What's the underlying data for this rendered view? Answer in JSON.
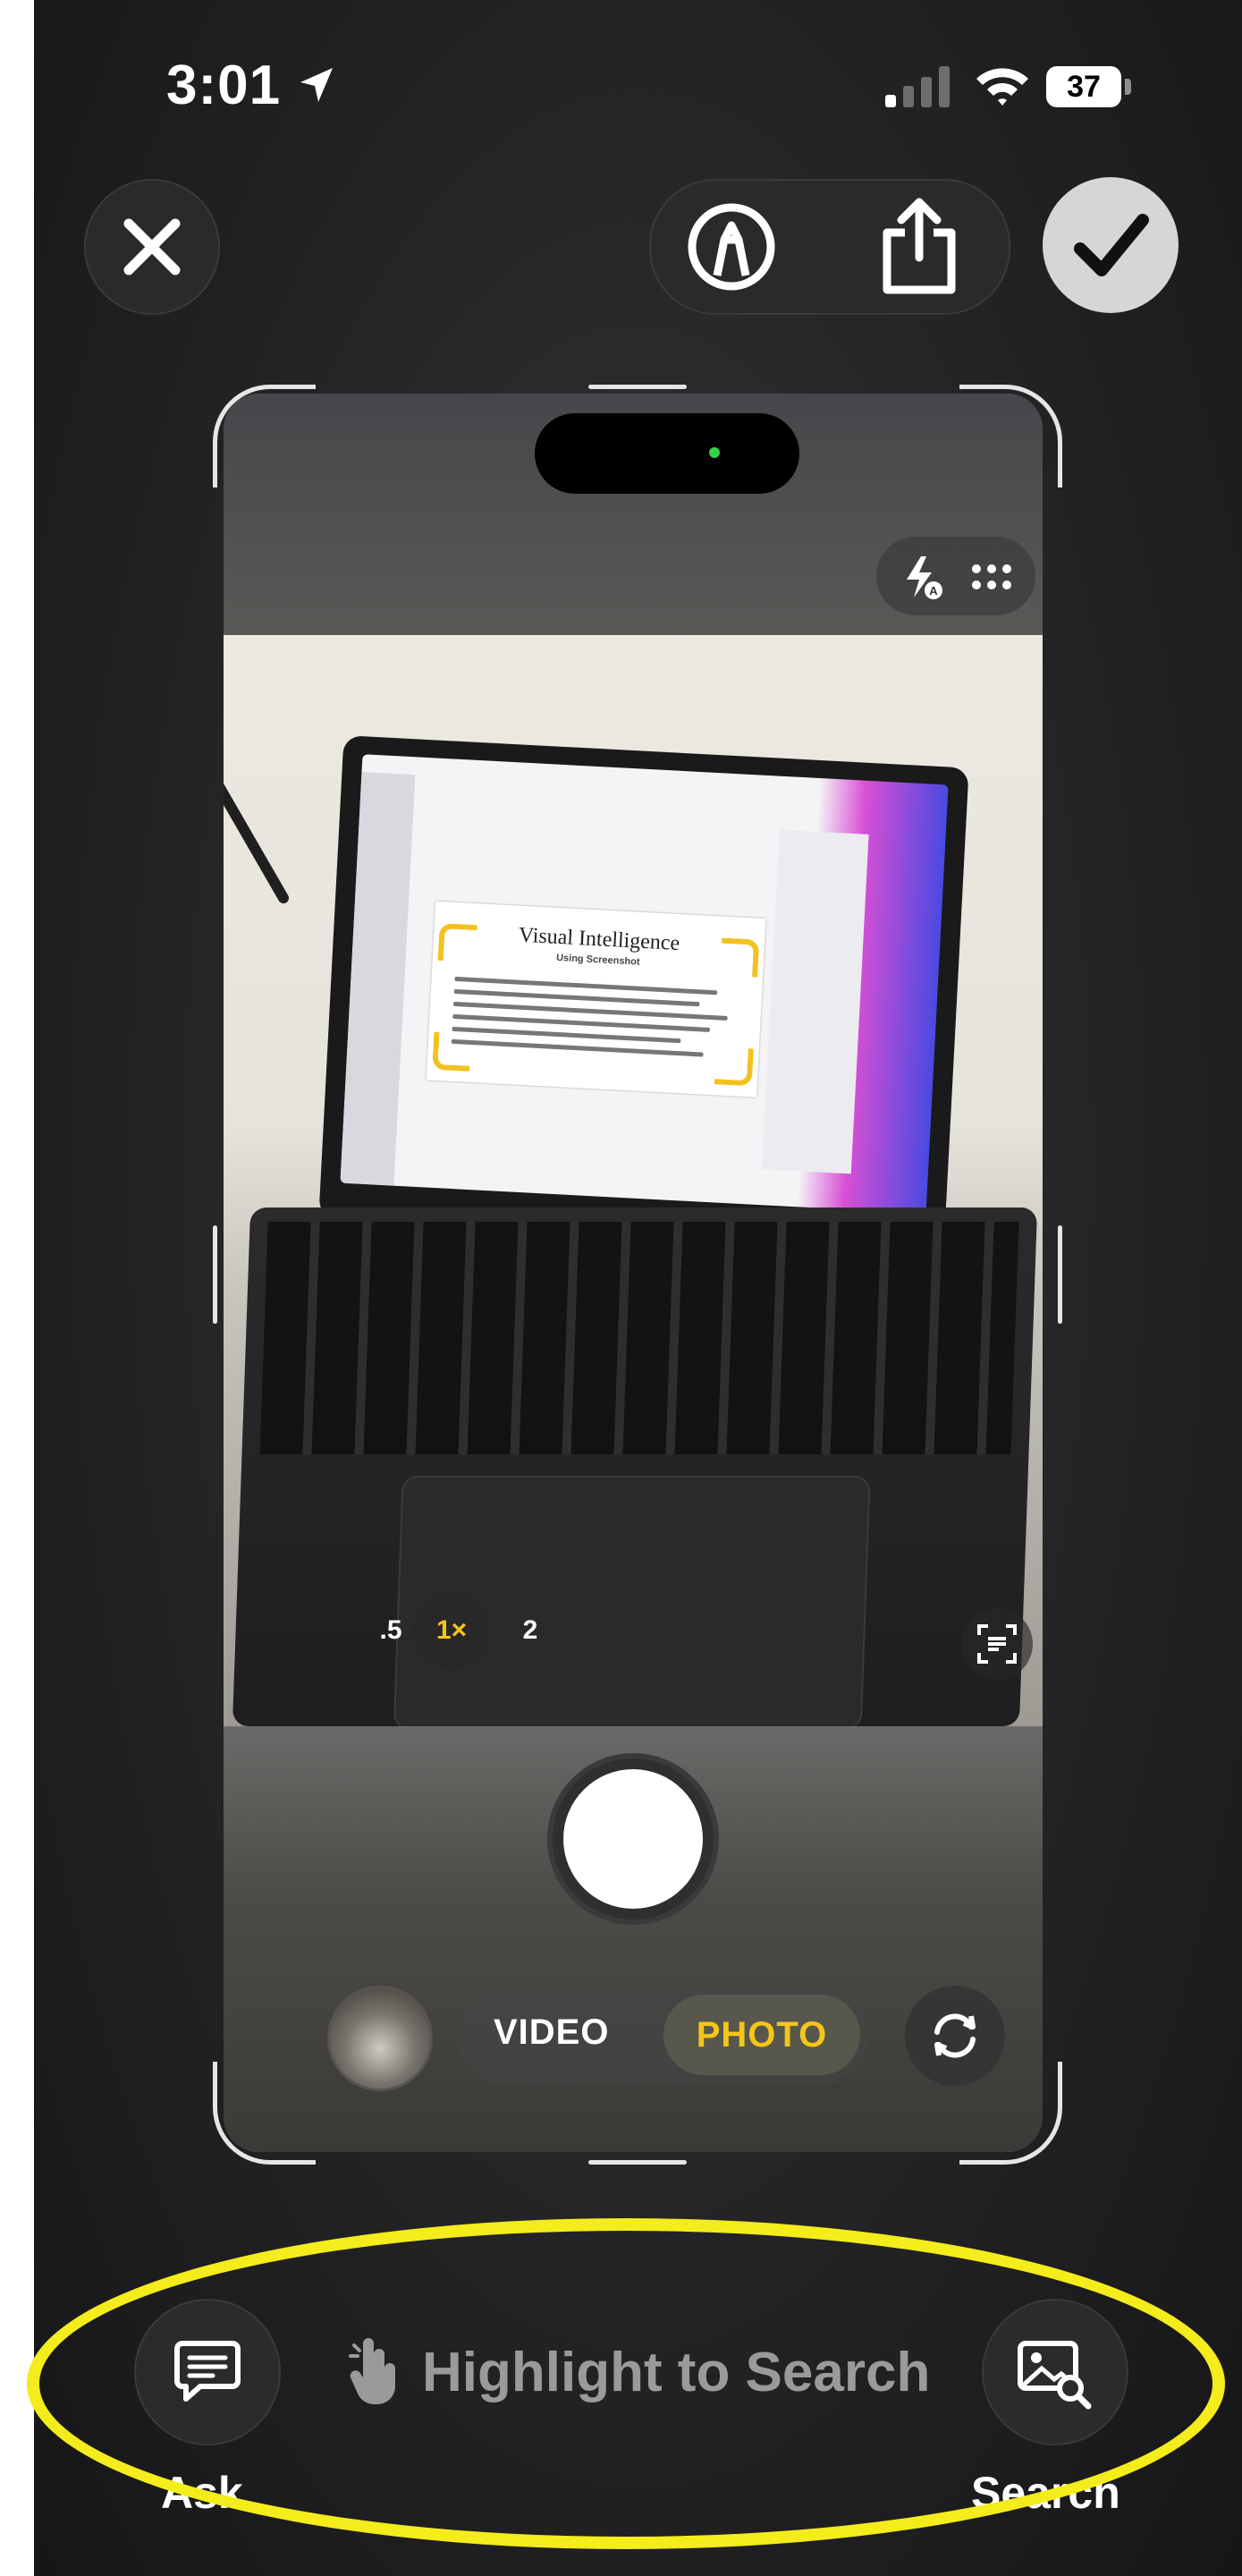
{
  "status_bar": {
    "time": "3:01",
    "battery_percent": "37"
  },
  "toolbar": {
    "close_icon": "close-icon",
    "markup_icon": "markup-pen-icon",
    "share_icon": "share-icon",
    "done_icon": "checkmark-icon"
  },
  "preview": {
    "slide_title": "Visual Intelligence",
    "slide_subtitle": "Using Screenshot",
    "zoom_options": [
      ".5",
      "1×",
      "2"
    ],
    "modes": {
      "video": "VIDEO",
      "photo": "PHOTO"
    }
  },
  "bottom_bar": {
    "ask_label": "Ask",
    "hint_text": "Highlight to Search",
    "search_label": "Search"
  },
  "colors": {
    "annotation": "#f4ec1b",
    "accent_yellow": "#f5c518"
  }
}
